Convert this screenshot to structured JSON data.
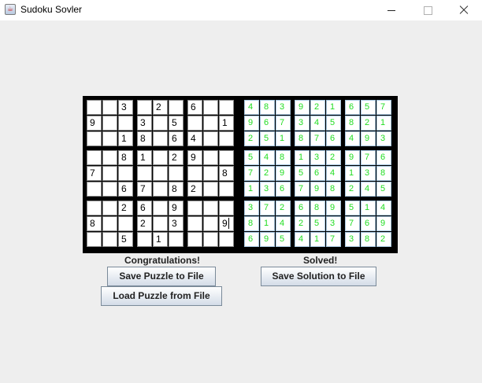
{
  "window": {
    "title": "Sudoku Sovler",
    "icon": "java-cup-icon"
  },
  "puzzle": [
    [
      "",
      "",
      "3",
      "",
      "2",
      "",
      "6",
      "",
      ""
    ],
    [
      "9",
      "",
      "",
      "3",
      "",
      "5",
      "",
      "",
      "1"
    ],
    [
      "",
      "",
      "1",
      "8",
      "",
      "6",
      "4",
      "",
      ""
    ],
    [
      "",
      "",
      "8",
      "1",
      "",
      "2",
      "9",
      "",
      ""
    ],
    [
      "7",
      "",
      "",
      "",
      "",
      "",
      "",
      "",
      "8"
    ],
    [
      "",
      "",
      "6",
      "7",
      "",
      "8",
      "2",
      "",
      ""
    ],
    [
      "",
      "",
      "2",
      "6",
      "",
      "9",
      "",
      "",
      ""
    ],
    [
      "8",
      "",
      "",
      "2",
      "",
      "3",
      "",
      "",
      "9"
    ],
    [
      "",
      "",
      "5",
      "",
      "1",
      "",
      "",
      "",
      ""
    ]
  ],
  "solution": [
    [
      "4",
      "8",
      "3",
      "9",
      "2",
      "1",
      "6",
      "5",
      "7"
    ],
    [
      "9",
      "6",
      "7",
      "3",
      "4",
      "5",
      "8",
      "2",
      "1"
    ],
    [
      "2",
      "5",
      "1",
      "8",
      "7",
      "6",
      "4",
      "9",
      "3"
    ],
    [
      "5",
      "4",
      "8",
      "1",
      "3",
      "2",
      "9",
      "7",
      "6"
    ],
    [
      "7",
      "2",
      "9",
      "5",
      "6",
      "4",
      "1",
      "3",
      "8"
    ],
    [
      "1",
      "3",
      "6",
      "7",
      "9",
      "8",
      "2",
      "4",
      "5"
    ],
    [
      "3",
      "7",
      "2",
      "6",
      "8",
      "9",
      "5",
      "1",
      "4"
    ],
    [
      "8",
      "1",
      "4",
      "2",
      "5",
      "3",
      "7",
      "6",
      "9"
    ],
    [
      "6",
      "9",
      "5",
      "4",
      "1",
      "7",
      "3",
      "8",
      "2"
    ]
  ],
  "status": {
    "puzzle_message": "Congratulations!",
    "solution_message": "Solved!"
  },
  "buttons": {
    "save_puzzle": "Save Puzzle to File",
    "load_puzzle": "Load Puzzle from File",
    "save_solution": "Save Solution to File"
  }
}
